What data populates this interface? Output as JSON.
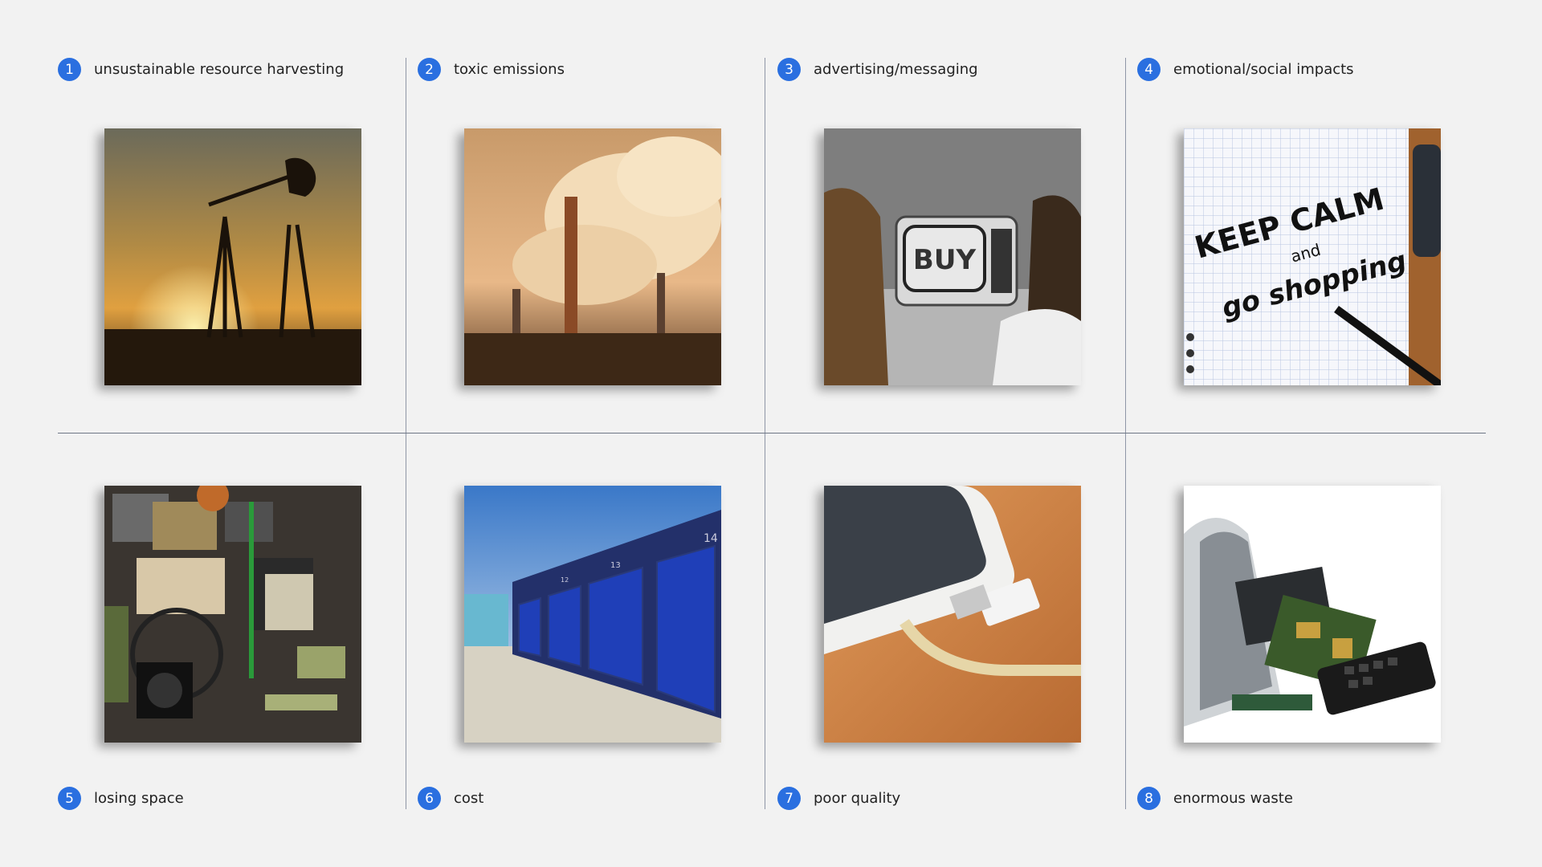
{
  "items": [
    {
      "number": "1",
      "label": "unsustainable resource harvesting",
      "icon": "oil-pumpjack-photo"
    },
    {
      "number": "2",
      "label": "toxic emissions",
      "icon": "factory-smokestack-photo"
    },
    {
      "number": "3",
      "label": "advertising/messaging",
      "icon": "tv-buy-photo",
      "tv_text": "BUY"
    },
    {
      "number": "4",
      "label": "emotional/social impacts",
      "icon": "notebook-photo",
      "note_lines": [
        "KEEP CALM",
        "and",
        "go shopping"
      ]
    },
    {
      "number": "5",
      "label": "losing space",
      "icon": "cluttered-garage-photo"
    },
    {
      "number": "6",
      "label": "cost",
      "icon": "storage-units-photo",
      "unit_numbers": [
        "14",
        "13",
        "12"
      ]
    },
    {
      "number": "7",
      "label": "poor quality",
      "icon": "broken-cable-photo"
    },
    {
      "number": "8",
      "label": "enormous waste",
      "icon": "ewaste-bin-photo"
    }
  ],
  "colors": {
    "accent": "#2a6fe0",
    "background": "#f2f2f2",
    "divider": "#8f96a6"
  }
}
